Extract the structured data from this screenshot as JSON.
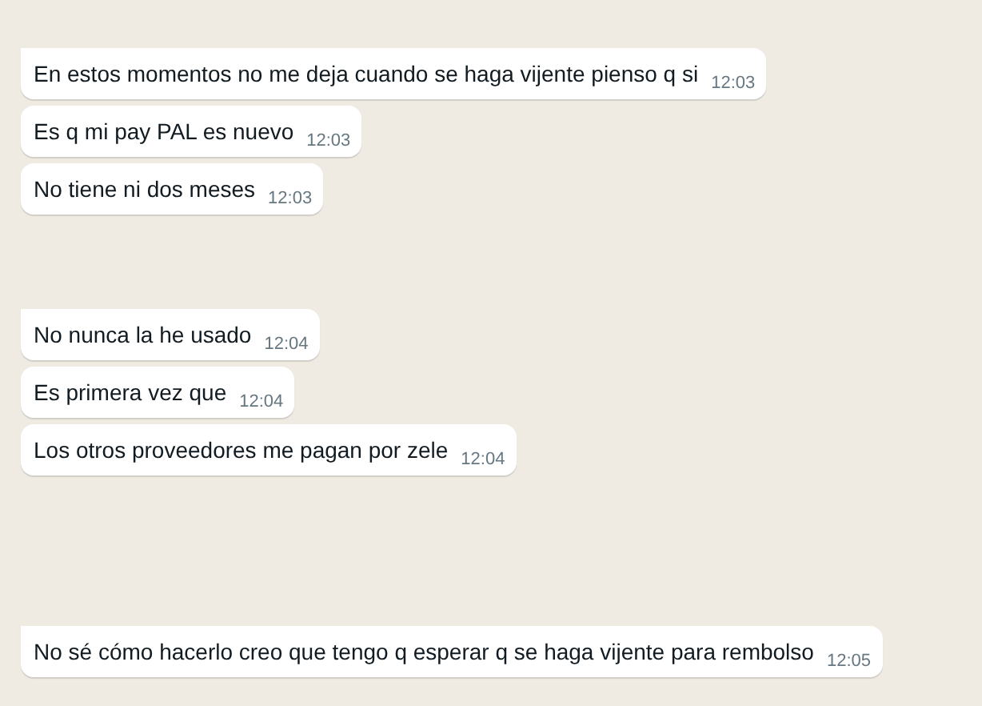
{
  "message_groups": [
    {
      "messages": [
        {
          "text": "En estos momentos no me deja cuando se haga vijente pienso q si",
          "time": "12:03"
        },
        {
          "text": "Es q mi pay PAL es nuevo",
          "time": "12:03"
        },
        {
          "text": "No tiene ni dos meses",
          "time": "12:03"
        }
      ]
    },
    {
      "messages": [
        {
          "text": "No nunca la he usado",
          "time": "12:04"
        },
        {
          "text": "Es primera vez que",
          "time": "12:04"
        },
        {
          "text": "Los otros proveedores me pagan por zele",
          "time": "12:04"
        }
      ]
    },
    {
      "messages": [
        {
          "text": "No sé cómo hacerlo creo que tengo q esperar q se haga vijente para rembolso",
          "time": "12:05"
        }
      ]
    }
  ]
}
